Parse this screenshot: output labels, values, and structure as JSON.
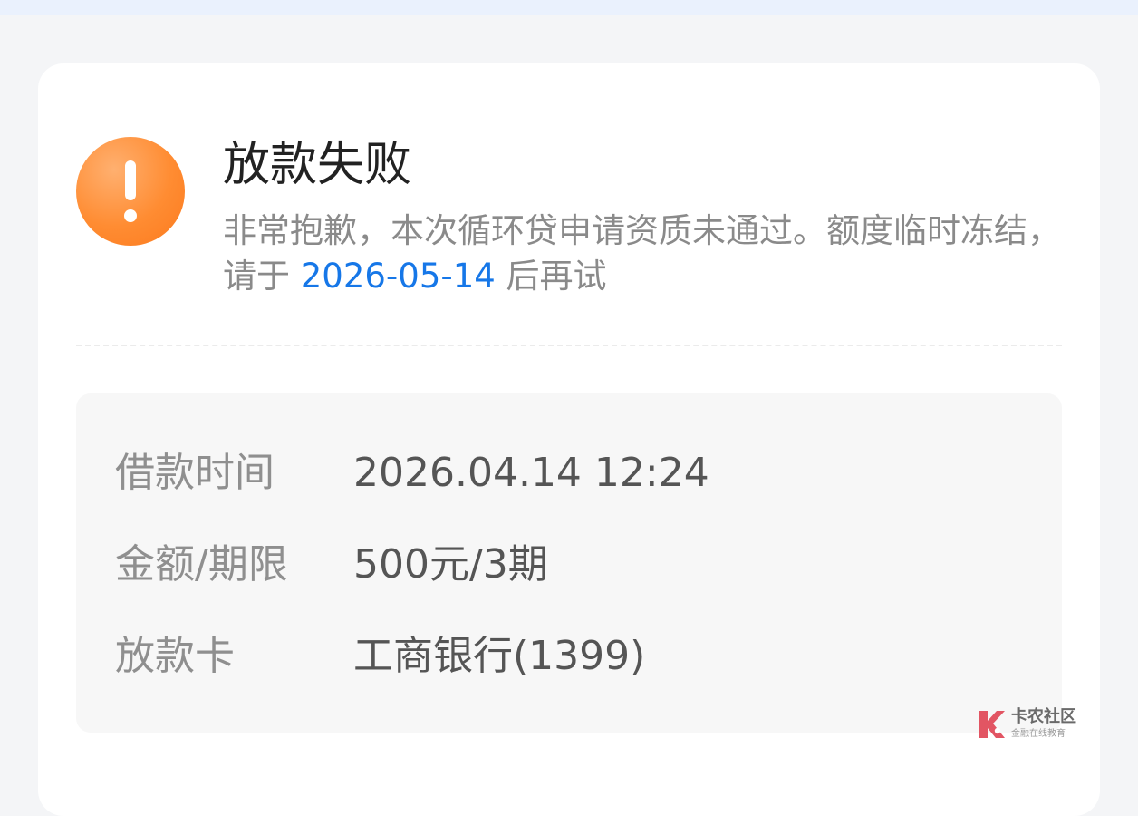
{
  "status": {
    "icon": "exclamation-icon",
    "title": "放款失败",
    "message_before_date": "非常抱歉，本次循环贷申请资质未通过。额度临时冻结，请于 ",
    "retry_date": "2026-05-14",
    "message_after_date": " 后再试"
  },
  "details": {
    "rows": [
      {
        "label": "借款时间",
        "value": "2026.04.14 12:24"
      },
      {
        "label": "金额/期限",
        "value": "500元/3期"
      },
      {
        "label": "放款卡",
        "value": "工商银行(1399)"
      }
    ]
  },
  "watermark": {
    "name": "卡农社区",
    "slogan": "金融在线教育"
  },
  "colors": {
    "accent_orange": "#ff8c32",
    "date_link_blue": "#1677e8",
    "watermark_red": "#e25563"
  }
}
